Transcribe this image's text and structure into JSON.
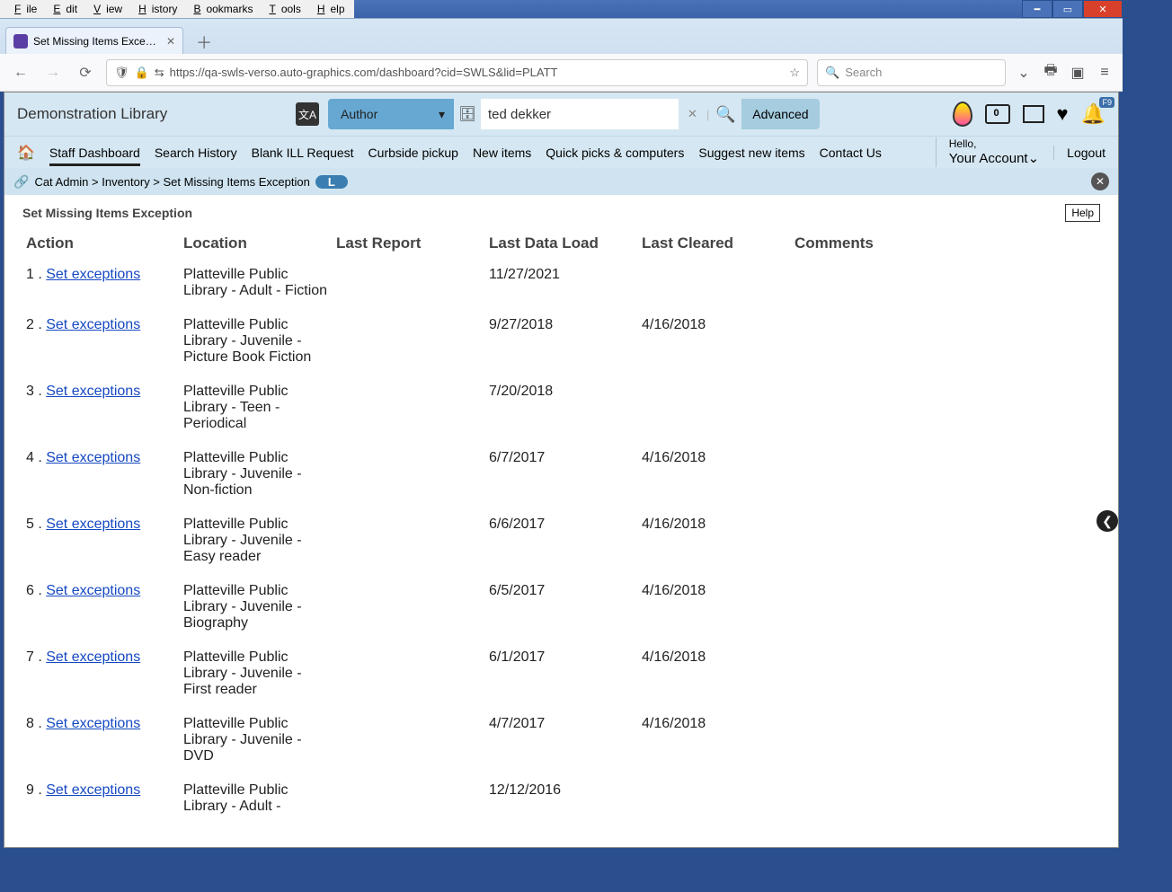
{
  "browser": {
    "menus": [
      "File",
      "Edit",
      "View",
      "History",
      "Bookmarks",
      "Tools",
      "Help"
    ],
    "tab_title": "Set Missing Items Exception | SV",
    "url": "https://qa-swls-verso.auto-graphics.com/dashboard?cid=SWLS&lid=PLATT",
    "search_placeholder": "Search"
  },
  "app": {
    "title": "Demonstration Library",
    "search_field_label": "Author",
    "search_value": "ted dekker",
    "advanced_label": "Advanced",
    "nav": [
      "Staff Dashboard",
      "Search History",
      "Blank ILL Request",
      "Curbside pickup",
      "New items",
      "Quick picks & computers",
      "Suggest new items",
      "Contact Us"
    ],
    "hello": "Hello,",
    "account": "Your Account",
    "logout": "Logout",
    "f9_badge": "F9"
  },
  "crumb": {
    "path": [
      "Cat Admin",
      "Inventory",
      "Set Missing Items Exception"
    ],
    "pill": "L"
  },
  "page": {
    "title": "Set Missing Items Exception",
    "help": "Help",
    "columns": [
      "Action",
      "Location",
      "Last Report",
      "Last Data Load",
      "Last Cleared",
      "Comments"
    ],
    "action_label": "Set exceptions",
    "rows": [
      {
        "n": "1",
        "loc": "Platteville Public Library - Adult - Fiction",
        "report": "",
        "load": "11/27/2021",
        "cleared": "",
        "comments": ""
      },
      {
        "n": "2",
        "loc": "Platteville Public Library - Juvenile - Picture Book Fiction",
        "report": "",
        "load": "9/27/2018",
        "cleared": "4/16/2018",
        "comments": ""
      },
      {
        "n": "3",
        "loc": "Platteville Public Library - Teen - Periodical",
        "report": "",
        "load": "7/20/2018",
        "cleared": "",
        "comments": ""
      },
      {
        "n": "4",
        "loc": "Platteville Public Library - Juvenile - Non-fiction",
        "report": "",
        "load": "6/7/2017",
        "cleared": "4/16/2018",
        "comments": ""
      },
      {
        "n": "5",
        "loc": "Platteville Public Library - Juvenile - Easy reader",
        "report": "",
        "load": "6/6/2017",
        "cleared": "4/16/2018",
        "comments": ""
      },
      {
        "n": "6",
        "loc": "Platteville Public Library - Juvenile - Biography",
        "report": "",
        "load": "6/5/2017",
        "cleared": "4/16/2018",
        "comments": ""
      },
      {
        "n": "7",
        "loc": "Platteville Public Library - Juvenile - First reader",
        "report": "",
        "load": "6/1/2017",
        "cleared": "4/16/2018",
        "comments": ""
      },
      {
        "n": "8",
        "loc": "Platteville Public Library - Juvenile - DVD",
        "report": "",
        "load": "4/7/2017",
        "cleared": "4/16/2018",
        "comments": ""
      },
      {
        "n": "9",
        "loc": "Platteville Public Library - Adult -",
        "report": "",
        "load": "12/12/2016",
        "cleared": "",
        "comments": ""
      }
    ]
  }
}
